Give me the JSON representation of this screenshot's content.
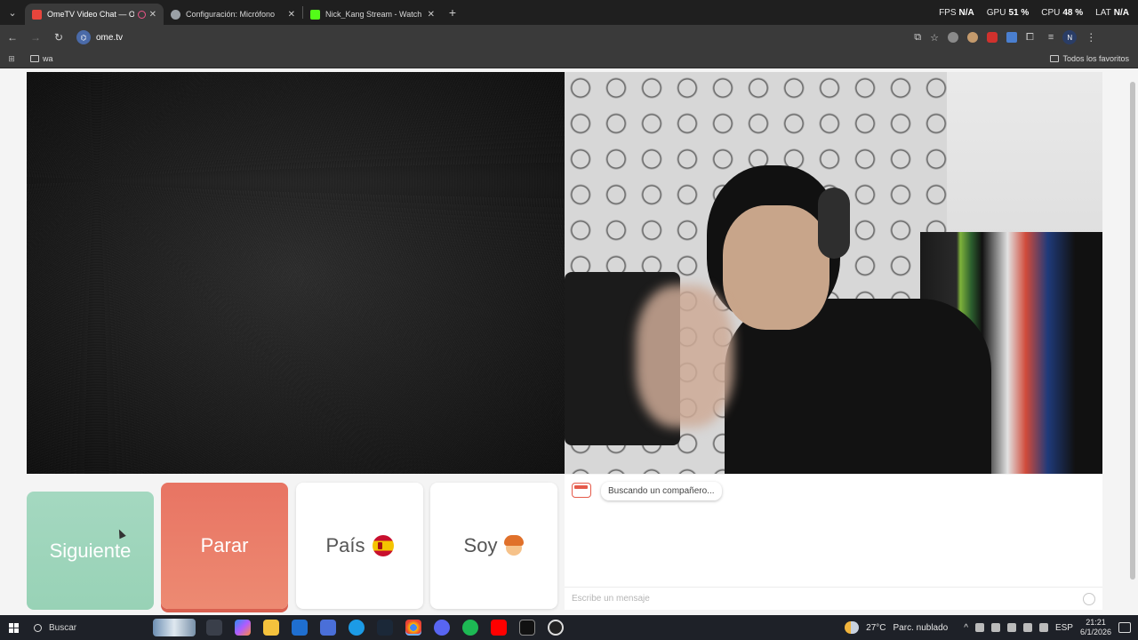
{
  "browser": {
    "tabs": [
      {
        "title": "OmeTV Video Chat — Ome",
        "active": true,
        "favicon_color": "#e8453c",
        "recording": true
      },
      {
        "title": "Configuración: Micrófono",
        "active": false,
        "favicon_color": "#9aa0a6"
      },
      {
        "title": "Nick_Kang Stream - Watch Live",
        "active": false,
        "favicon_color": "#53fc18"
      }
    ],
    "hud": {
      "fps_label": "FPS",
      "fps_value": "N/A",
      "gpu_label": "GPU",
      "gpu_value": "51 %",
      "cpu_label": "CPU",
      "cpu_value": "48 %",
      "lat_label": "LAT",
      "lat_value": "N/A"
    },
    "url": "ome.tv",
    "profile_initial": "N",
    "bookmarks": {
      "left": "wa",
      "right": "Todos los favoritos"
    }
  },
  "controls": {
    "next_label": "Siguiente",
    "stop_label": "Parar",
    "country_label": "País",
    "country_emoji": "spain-flag",
    "gender_label": "Soy",
    "gender_emoji": "boy"
  },
  "chat": {
    "status_message": "Buscando un compañero...",
    "input_placeholder": "Escribe un mensaje"
  },
  "taskbar": {
    "search_label": "Buscar",
    "weather_temp": "27°C",
    "weather_desc": "Parc. nublado",
    "language": "ESP",
    "time": "21:21",
    "date": "6/1/2026"
  },
  "colors": {
    "next_button": "#9dd5bb",
    "stop_button": "#ea7d6a",
    "brand": "#e55a4a"
  }
}
